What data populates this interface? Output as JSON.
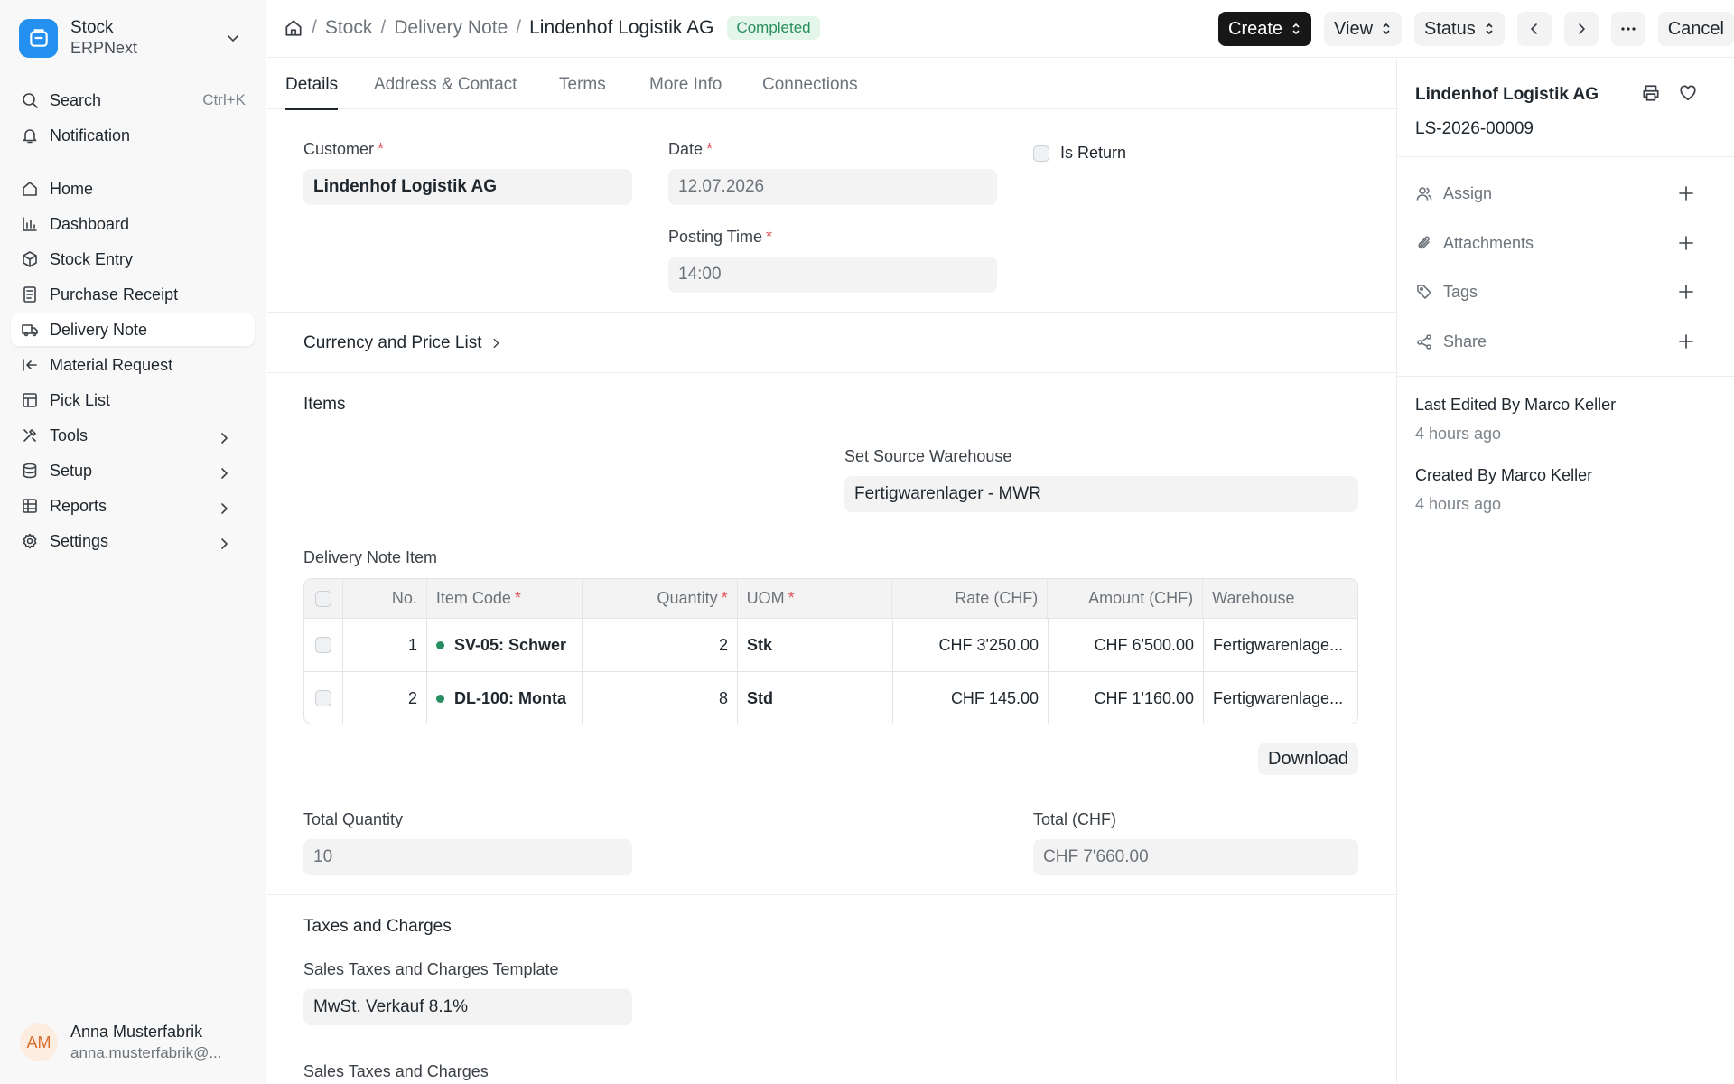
{
  "app": {
    "name": "Stock",
    "subtitle": "ERPNext"
  },
  "sidebar": {
    "search": {
      "label": "Search",
      "shortcut": "Ctrl+K"
    },
    "notification": "Notification",
    "items": [
      {
        "label": "Home",
        "icon": "home-icon"
      },
      {
        "label": "Dashboard",
        "icon": "chart-icon"
      },
      {
        "label": "Stock Entry",
        "icon": "box-icon"
      },
      {
        "label": "Purchase Receipt",
        "icon": "receipt-icon"
      },
      {
        "label": "Delivery Note",
        "icon": "truck-icon",
        "active": true
      },
      {
        "label": "Material Request",
        "icon": "arrow-left-icon"
      },
      {
        "label": "Pick List",
        "icon": "pick-list-icon"
      },
      {
        "label": "Tools",
        "icon": "tools-icon"
      },
      {
        "label": "Setup",
        "icon": "database-icon"
      },
      {
        "label": "Reports",
        "icon": "table-icon"
      },
      {
        "label": "Settings",
        "icon": "gear-icon"
      }
    ],
    "user": {
      "initials": "AM",
      "name": "Anna Musterfabrik",
      "email": "anna.musterfabrik@..."
    }
  },
  "breadcrumb": {
    "root": "Stock",
    "doctype": "Delivery Note",
    "doc": "Lindenhof Logistik AG",
    "status": "Completed"
  },
  "toolbar": {
    "create": "Create",
    "view": "View",
    "status": "Status",
    "cancel": "Cancel"
  },
  "tabs": [
    "Details",
    "Address & Contact",
    "Terms",
    "More Info",
    "Connections"
  ],
  "form": {
    "customer_label": "Customer",
    "customer": "Lindenhof Logistik AG",
    "date_label": "Date",
    "date": "12.07.2026",
    "posting_time_label": "Posting Time",
    "posting_time": "14:00",
    "is_return_label": "Is Return",
    "currency_section": "Currency and Price List",
    "items_section": "Items",
    "source_wh_label": "Set Source Warehouse",
    "source_wh": "Fertigwarenlager - MWR",
    "items_table_label": "Delivery Note Item",
    "download": "Download",
    "total_qty_label": "Total Quantity",
    "total_qty": "10",
    "total_label": "Total (CHF)",
    "total": "CHF 7'660.00",
    "taxes_section": "Taxes and Charges",
    "tax_template_label": "Sales Taxes and Charges Template",
    "tax_template": "MwSt. Verkauf 8.1%",
    "taxes_table_label": "Sales Taxes and Charges"
  },
  "table": {
    "headers": {
      "no": "No.",
      "item_code": "Item Code",
      "qty": "Quantity",
      "uom": "UOM",
      "rate": "Rate (CHF)",
      "amount": "Amount (CHF)",
      "warehouse": "Warehouse"
    },
    "rows": [
      {
        "no": "1",
        "item_code": "SV-05: Schwer",
        "qty": "2",
        "uom": "Stk",
        "rate": "CHF 3'250.00",
        "amount": "CHF 6'500.00",
        "warehouse": "Fertigwarenlage..."
      },
      {
        "no": "2",
        "item_code": "DL-100: Monta",
        "qty": "8",
        "uom": "Std",
        "rate": "CHF 145.00",
        "amount": "CHF 1'160.00",
        "warehouse": "Fertigwarenlage..."
      }
    ]
  },
  "panel": {
    "title": "Lindenhof Logistik AG",
    "id": "LS-2026-00009",
    "assign": "Assign",
    "attachments": "Attachments",
    "tags": "Tags",
    "share": "Share",
    "last_edited": "Last Edited By Marco Keller",
    "last_edited_ago": "4 hours ago",
    "created": "Created By Marco Keller",
    "created_ago": "4 hours ago"
  },
  "colors": {
    "accent": "#2490ef",
    "status_green": "#278f5e",
    "required": "#e2555b"
  }
}
